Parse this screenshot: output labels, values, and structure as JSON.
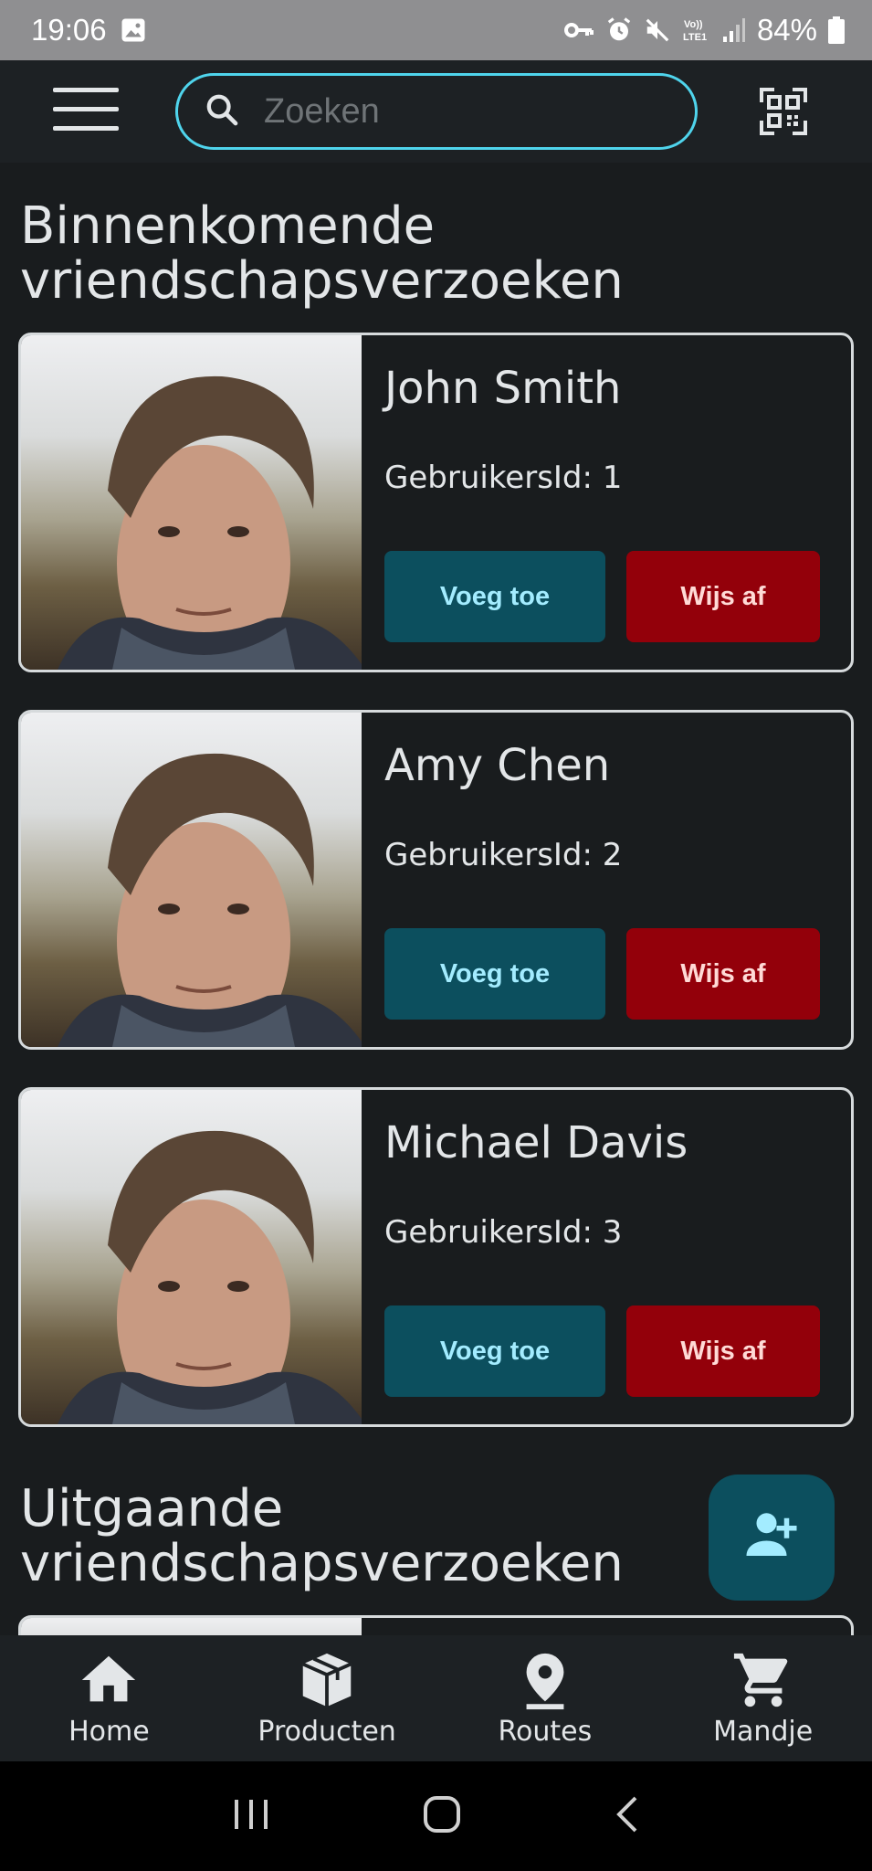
{
  "status_bar": {
    "time": "19:06",
    "battery": "84%",
    "icons": [
      "image-icon",
      "key-icon",
      "alarm-icon",
      "mute-icon",
      "volte-icon",
      "signal-icon",
      "battery-icon"
    ]
  },
  "top_bar": {
    "search_placeholder": "Zoeken",
    "icons": [
      "menu-icon",
      "search-icon",
      "qr-code-icon"
    ]
  },
  "incoming": {
    "title_line1": "Binnenkomende",
    "title_line2": "vriendschapsverzoeken",
    "requests": [
      {
        "name": "John Smith",
        "user_id": "GebruikersId: 1",
        "accept": "Voeg toe",
        "reject": "Wijs af"
      },
      {
        "name": "Amy Chen",
        "user_id": "GebruikersId: 2",
        "accept": "Voeg toe",
        "reject": "Wijs af"
      },
      {
        "name": "Michael Davis",
        "user_id": "GebruikersId: 3",
        "accept": "Voeg toe",
        "reject": "Wijs af"
      }
    ]
  },
  "outgoing": {
    "title_line1": "Uitgaande",
    "title_line2": "vriendschapsverzoeken"
  },
  "bottom_nav": [
    {
      "label": "Home",
      "icon": "home-icon"
    },
    {
      "label": "Producten",
      "icon": "box-icon"
    },
    {
      "label": "Routes",
      "icon": "location-pin-icon"
    },
    {
      "label": "Mandje",
      "icon": "cart-icon"
    }
  ],
  "colors": {
    "background": "#191c1e",
    "accent": "#4fd4ec",
    "accept_button": "#0c4f5e",
    "reject_button": "#93000a"
  }
}
